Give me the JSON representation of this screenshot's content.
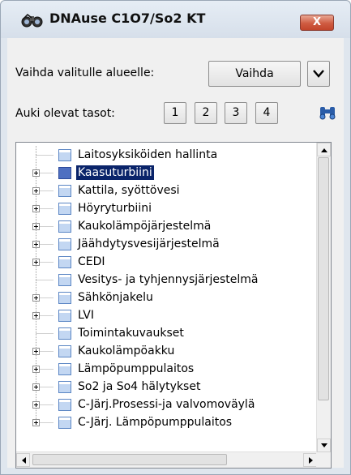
{
  "window": {
    "title": "DNAuse C1O7/So2 KT",
    "close_label": "X"
  },
  "controls": {
    "area_label": "Vaihda valitulle alueelle:",
    "vaihda_button": "Vaihda",
    "levels_label": "Auki olevat tasot:",
    "levels": [
      "1",
      "2",
      "3",
      "4"
    ]
  },
  "icons": {
    "app_icon": "binoculars-app-icon",
    "dropdown": "chevron-down-icon",
    "find": "binoculars-icon"
  },
  "colors": {
    "selection": "#0a246a",
    "close_button": "#cf5b41"
  },
  "tree": {
    "items": [
      {
        "label": "Laitosyksiköiden hallinta",
        "expandable": false,
        "selected": false
      },
      {
        "label": "Kaasuturbiini",
        "expandable": true,
        "selected": true
      },
      {
        "label": "Kattila, syöttövesi",
        "expandable": true,
        "selected": false
      },
      {
        "label": "Höyryturbiini",
        "expandable": true,
        "selected": false
      },
      {
        "label": "Kaukolämpöjärjestelmä",
        "expandable": true,
        "selected": false
      },
      {
        "label": "Jäähdytysvesijärjestelmä",
        "expandable": true,
        "selected": false
      },
      {
        "label": "CEDI",
        "expandable": true,
        "selected": false
      },
      {
        "label": "Vesitys- ja tyhjennysjärjestelmä",
        "expandable": false,
        "selected": false
      },
      {
        "label": "Sähkönjakelu",
        "expandable": true,
        "selected": false
      },
      {
        "label": "LVI",
        "expandable": true,
        "selected": false
      },
      {
        "label": "Toimintakuvaukset",
        "expandable": false,
        "selected": false
      },
      {
        "label": "Kaukolämpöakku",
        "expandable": true,
        "selected": false
      },
      {
        "label": "Lämpöpumppulaitos",
        "expandable": true,
        "selected": false
      },
      {
        "label": "So2 ja So4 hälytykset",
        "expandable": true,
        "selected": false
      },
      {
        "label": "C-Järj.Prosessi-ja valvomoväylä",
        "expandable": true,
        "selected": false
      },
      {
        "label": "C-Järj. Lämpöpumppulaitos",
        "expandable": true,
        "selected": false
      }
    ]
  }
}
